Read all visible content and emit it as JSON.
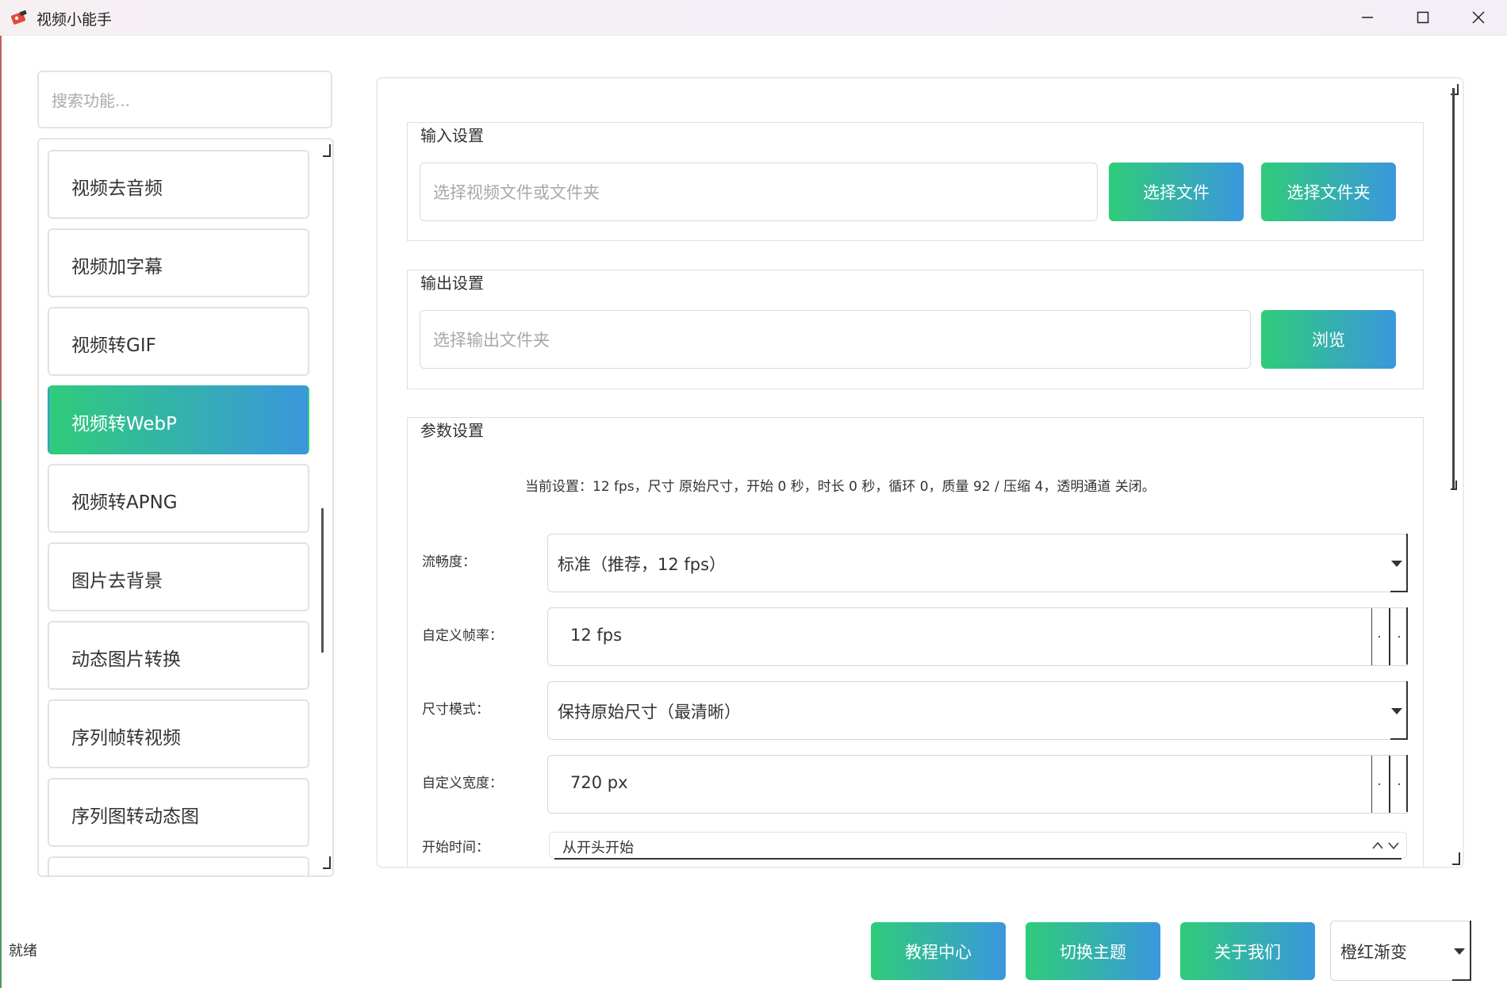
{
  "window": {
    "title": "视频小能手",
    "accent_gradient": [
      "#2fcc7a",
      "#3a97dd"
    ]
  },
  "sidebar": {
    "search_placeholder": "搜索功能...",
    "items": [
      {
        "label": "视频去音频",
        "active": false
      },
      {
        "label": "视频加字幕",
        "active": false
      },
      {
        "label": "视频转GIF",
        "active": false
      },
      {
        "label": "视频转WebP",
        "active": true
      },
      {
        "label": "视频转APNG",
        "active": false
      },
      {
        "label": "图片去背景",
        "active": false
      },
      {
        "label": "动态图片转换",
        "active": false
      },
      {
        "label": "序列帧转视频",
        "active": false
      },
      {
        "label": "序列图转动态图",
        "active": false
      }
    ]
  },
  "input_group": {
    "title": "输入设置",
    "placeholder": "选择视频文件或文件夹",
    "select_file_label": "选择文件",
    "select_folder_label": "选择文件夹"
  },
  "output_group": {
    "title": "输出设置",
    "placeholder": "选择输出文件夹",
    "browse_label": "浏览"
  },
  "params": {
    "title": "参数设置",
    "current_settings": "当前设置：12 fps，尺寸 原始尺寸，开始 0 秒，时长 0 秒，循环 0，质量 92 / 压缩 4，透明通道 关闭。",
    "smoothness": {
      "label": "流畅度：",
      "value": "标准（推荐，12 fps）"
    },
    "framerate": {
      "label": "自定义帧率：",
      "value": "12 fps"
    },
    "size_mode": {
      "label": "尺寸模式：",
      "value": "保持原始尺寸（最清晰）"
    },
    "width": {
      "label": "自定义宽度：",
      "value": "720 px"
    },
    "start_time": {
      "label": "开始时间：",
      "value": "从开头开始"
    }
  },
  "footer": {
    "status": "就绪",
    "tutorial_label": "教程中心",
    "switch_theme_label": "切换主题",
    "about_label": "关于我们",
    "theme_value": "橙红渐变"
  }
}
